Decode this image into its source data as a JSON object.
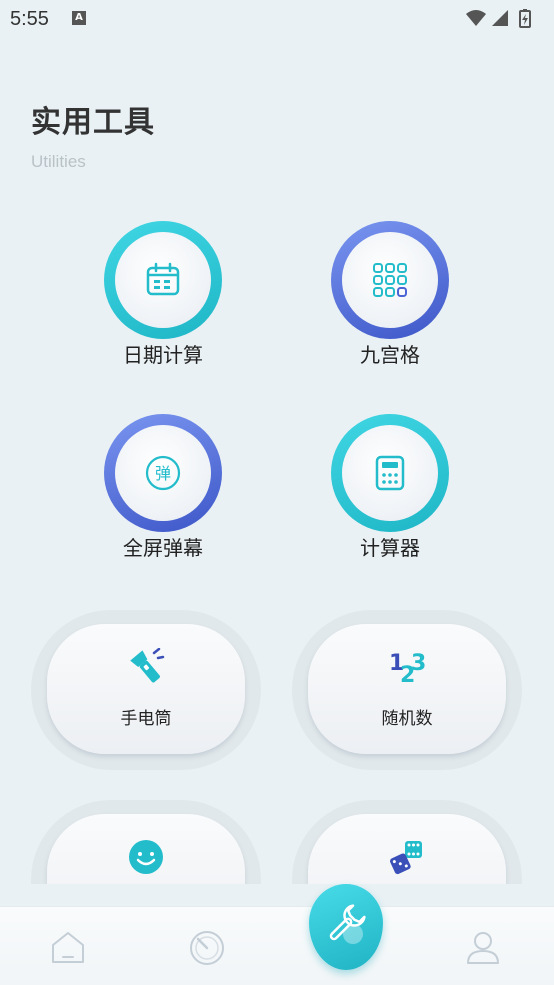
{
  "status_bar": {
    "time": "5:55",
    "notification_badge": "A"
  },
  "header": {
    "title": "实用工具",
    "subtitle": "Utilities"
  },
  "tools": [
    {
      "label": "日期计算",
      "icon": "calendar-icon",
      "ring": "teal"
    },
    {
      "label": "九宫格",
      "icon": "grid-icon",
      "ring": "blue"
    },
    {
      "label": "全屏弹幕",
      "icon": "danmaku-icon",
      "ring": "blue",
      "icon_text": "弹"
    },
    {
      "label": "计算器",
      "icon": "calculator-icon",
      "ring": "teal"
    }
  ],
  "cards": [
    {
      "label": "手电筒",
      "icon": "flashlight-icon"
    },
    {
      "label": "随机数",
      "icon": "random-number-icon",
      "icon_text": "123"
    },
    {
      "label": "",
      "icon": "smiley-icon"
    },
    {
      "label": "",
      "icon": "dice-icon"
    }
  ],
  "bottom_nav": [
    {
      "icon": "home-icon",
      "active": false
    },
    {
      "icon": "speedometer-icon",
      "active": false
    },
    {
      "icon": "wrench-icon",
      "active": true
    },
    {
      "icon": "profile-icon",
      "active": false
    }
  ],
  "colors": {
    "teal": "#22bccb",
    "blue": "#4a64d6",
    "background": "#e9f1f4"
  }
}
